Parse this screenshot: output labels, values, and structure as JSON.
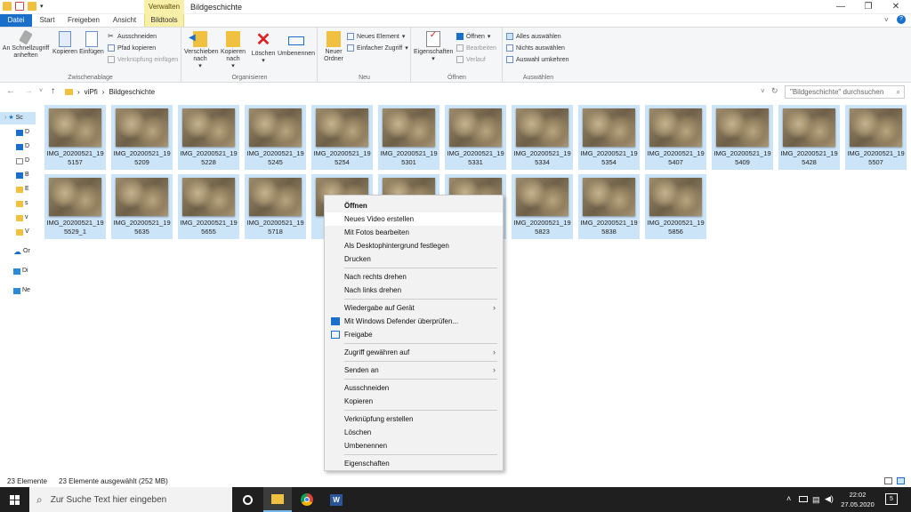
{
  "window": {
    "title": "Bildgeschichte",
    "context_tab_group": "Verwalten"
  },
  "tabs": {
    "file": "Datei",
    "start": "Start",
    "share": "Freigeben",
    "view": "Ansicht",
    "picture_tools": "Bildtools"
  },
  "ribbon": {
    "clipboard": {
      "label": "Zwischenablage",
      "pin": "An Schnellzugriff anheften",
      "copy": "Kopieren",
      "paste": "Einfügen",
      "cut": "Ausschneiden",
      "copy_path": "Pfad kopieren",
      "paste_shortcut": "Verknüpfung einfügen"
    },
    "organize": {
      "label": "Organisieren",
      "move": "Verschieben nach",
      "copy_to": "Kopieren nach",
      "delete": "Löschen",
      "rename": "Umbenennen"
    },
    "new": {
      "label": "Neu",
      "new_folder": "Neuer Ordner",
      "new_item": "Neues Element",
      "easy_access": "Einfacher Zugriff"
    },
    "open": {
      "label": "Öffnen",
      "properties": "Eigenschaften",
      "open": "Öffnen",
      "edit": "Bearbeiten",
      "history": "Verlauf"
    },
    "select": {
      "label": "Auswählen",
      "select_all": "Alles auswählen",
      "select_none": "Nichts auswählen",
      "invert": "Auswahl umkehren"
    }
  },
  "address": {
    "crumbs": [
      "viPfi",
      "Bildgeschichte"
    ],
    "search_placeholder": "\"Bildgeschichte\" durchsuchen"
  },
  "navpane": [
    "Sc",
    "D",
    "D",
    "D",
    "B",
    "E",
    "s",
    "v",
    "V",
    "Or",
    "Di",
    "Ne"
  ],
  "files": [
    {
      "name": "IMG_20200521_195157"
    },
    {
      "name": "IMG_20200521_195209"
    },
    {
      "name": "IMG_20200521_195228"
    },
    {
      "name": "IMG_20200521_195245"
    },
    {
      "name": "IMG_20200521_195254"
    },
    {
      "name": "IMG_20200521_195301"
    },
    {
      "name": "IMG_20200521_195331"
    },
    {
      "name": "IMG_20200521_195334"
    },
    {
      "name": "IMG_20200521_195354"
    },
    {
      "name": "IMG_20200521_195407"
    },
    {
      "name": "IMG_20200521_195409"
    },
    {
      "name": "IMG_20200521_195428"
    },
    {
      "name": "IMG_20200521_195507"
    },
    {
      "name": "IMG_20200521_195529_1"
    },
    {
      "name": "IMG_20200521_195635"
    },
    {
      "name": "IMG_20200521_195655"
    },
    {
      "name": "IMG_20200521_195718"
    },
    {
      "name": ""
    },
    {
      "name": ""
    },
    {
      "name": ""
    },
    {
      "name": "IMG_20200521_195823"
    },
    {
      "name": "IMG_20200521_195838"
    },
    {
      "name": "IMG_20200521_195856"
    }
  ],
  "context_menu": [
    {
      "label": "Öffnen",
      "bold": true
    },
    {
      "label": "Neues Video erstellen",
      "hover": true
    },
    {
      "label": "Mit Fotos bearbeiten"
    },
    {
      "label": "Als Desktophintergrund festlegen"
    },
    {
      "label": "Drucken"
    },
    {
      "sep": true
    },
    {
      "label": "Nach rechts drehen"
    },
    {
      "label": "Nach links drehen"
    },
    {
      "sep": true
    },
    {
      "label": "Wiedergabe auf Gerät",
      "submenu": true
    },
    {
      "label": "Mit Windows Defender überprüfen...",
      "icon": "defender-icon"
    },
    {
      "label": "Freigabe",
      "icon": "share-icon"
    },
    {
      "sep": true
    },
    {
      "label": "Zugriff gewähren auf",
      "submenu": true
    },
    {
      "sep": true
    },
    {
      "label": "Senden an",
      "submenu": true
    },
    {
      "sep": true
    },
    {
      "label": "Ausschneiden"
    },
    {
      "label": "Kopieren"
    },
    {
      "sep": true
    },
    {
      "label": "Verknüpfung erstellen"
    },
    {
      "label": "Löschen"
    },
    {
      "label": "Umbenennen"
    },
    {
      "sep": true
    },
    {
      "label": "Eigenschaften"
    }
  ],
  "status": {
    "count": "23 Elemente",
    "selected": "23 Elemente ausgewählt (252 MB)"
  },
  "taskbar": {
    "search_placeholder": "Zur Suche Text hier eingeben",
    "time": "22:02",
    "date": "27.05.2020",
    "notifications": "5"
  }
}
